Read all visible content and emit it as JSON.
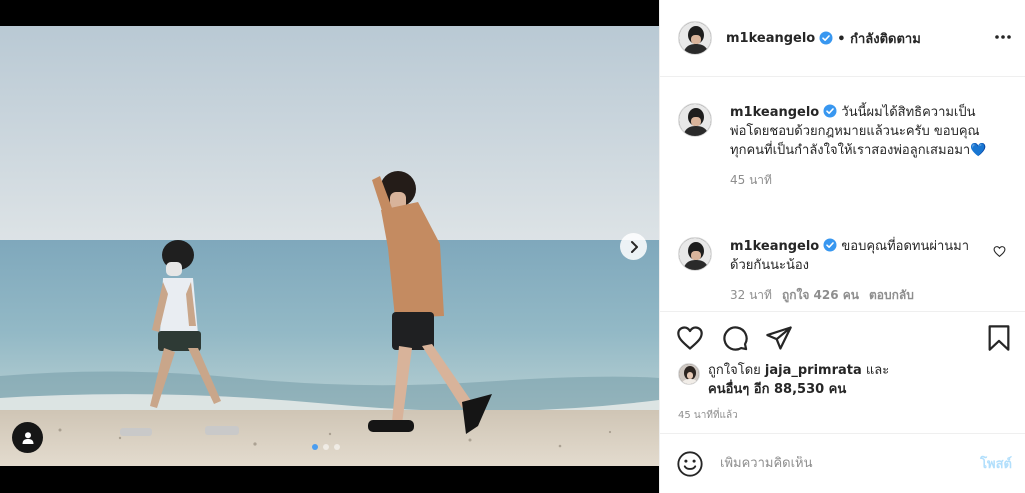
{
  "post": {
    "username": "m1keangelo",
    "follow_state": "• กำลังติดตาม",
    "verified": true
  },
  "media": {
    "slide_count": 3,
    "active_slide": 1
  },
  "caption": {
    "username": "m1keangelo",
    "text": "วันนี้ผมได้สิทธิความเป็นพ่อโดยชอบด้วยกฎหมายแล้วนะครับ ขอบคุณทุกคนที่เป็นกำลังใจให้เราสองพ่อลูกเสมอมา💙",
    "time": "45 นาที"
  },
  "reply": {
    "username": "m1keangelo",
    "text": "ขอบคุณที่อดทนผ่านมาด้วยกันนะน้อง",
    "time": "32 นาที",
    "likes": "ถูกใจ 426 คน",
    "reply_label": "ตอบกลับ"
  },
  "likes": {
    "prefix": "ถูกใจโดย",
    "user": "jaja_primrata",
    "and": "และ",
    "others": "คนอื่นๆ อีก 88,530 คน"
  },
  "posted_ago": "45 นาทีที่แล้ว",
  "add_comment": {
    "placeholder": "เพิ่มความคิดเห็น",
    "post_label": "โพสต์"
  },
  "colors": {
    "verified": "#3897f0",
    "link_disabled": "#b2dffc",
    "muted": "#8e8e8e"
  }
}
